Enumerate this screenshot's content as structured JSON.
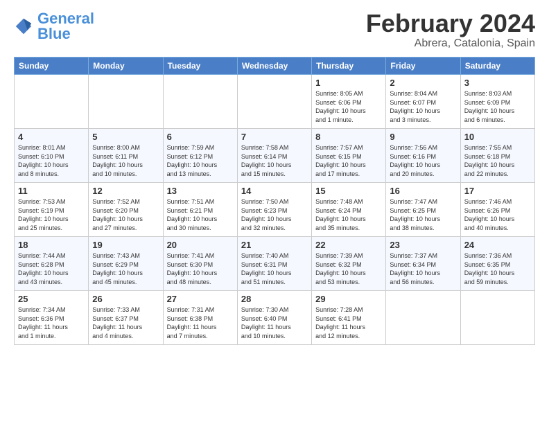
{
  "logo": {
    "line1": "General",
    "line2": "Blue"
  },
  "title": "February 2024",
  "location": "Abrera, Catalonia, Spain",
  "weekdays": [
    "Sunday",
    "Monday",
    "Tuesday",
    "Wednesday",
    "Thursday",
    "Friday",
    "Saturday"
  ],
  "weeks": [
    [
      {
        "day": "",
        "details": ""
      },
      {
        "day": "",
        "details": ""
      },
      {
        "day": "",
        "details": ""
      },
      {
        "day": "",
        "details": ""
      },
      {
        "day": "1",
        "details": "Sunrise: 8:05 AM\nSunset: 6:06 PM\nDaylight: 10 hours\nand 1 minute."
      },
      {
        "day": "2",
        "details": "Sunrise: 8:04 AM\nSunset: 6:07 PM\nDaylight: 10 hours\nand 3 minutes."
      },
      {
        "day": "3",
        "details": "Sunrise: 8:03 AM\nSunset: 6:09 PM\nDaylight: 10 hours\nand 6 minutes."
      }
    ],
    [
      {
        "day": "4",
        "details": "Sunrise: 8:01 AM\nSunset: 6:10 PM\nDaylight: 10 hours\nand 8 minutes."
      },
      {
        "day": "5",
        "details": "Sunrise: 8:00 AM\nSunset: 6:11 PM\nDaylight: 10 hours\nand 10 minutes."
      },
      {
        "day": "6",
        "details": "Sunrise: 7:59 AM\nSunset: 6:12 PM\nDaylight: 10 hours\nand 13 minutes."
      },
      {
        "day": "7",
        "details": "Sunrise: 7:58 AM\nSunset: 6:14 PM\nDaylight: 10 hours\nand 15 minutes."
      },
      {
        "day": "8",
        "details": "Sunrise: 7:57 AM\nSunset: 6:15 PM\nDaylight: 10 hours\nand 17 minutes."
      },
      {
        "day": "9",
        "details": "Sunrise: 7:56 AM\nSunset: 6:16 PM\nDaylight: 10 hours\nand 20 minutes."
      },
      {
        "day": "10",
        "details": "Sunrise: 7:55 AM\nSunset: 6:18 PM\nDaylight: 10 hours\nand 22 minutes."
      }
    ],
    [
      {
        "day": "11",
        "details": "Sunrise: 7:53 AM\nSunset: 6:19 PM\nDaylight: 10 hours\nand 25 minutes."
      },
      {
        "day": "12",
        "details": "Sunrise: 7:52 AM\nSunset: 6:20 PM\nDaylight: 10 hours\nand 27 minutes."
      },
      {
        "day": "13",
        "details": "Sunrise: 7:51 AM\nSunset: 6:21 PM\nDaylight: 10 hours\nand 30 minutes."
      },
      {
        "day": "14",
        "details": "Sunrise: 7:50 AM\nSunset: 6:23 PM\nDaylight: 10 hours\nand 32 minutes."
      },
      {
        "day": "15",
        "details": "Sunrise: 7:48 AM\nSunset: 6:24 PM\nDaylight: 10 hours\nand 35 minutes."
      },
      {
        "day": "16",
        "details": "Sunrise: 7:47 AM\nSunset: 6:25 PM\nDaylight: 10 hours\nand 38 minutes."
      },
      {
        "day": "17",
        "details": "Sunrise: 7:46 AM\nSunset: 6:26 PM\nDaylight: 10 hours\nand 40 minutes."
      }
    ],
    [
      {
        "day": "18",
        "details": "Sunrise: 7:44 AM\nSunset: 6:28 PM\nDaylight: 10 hours\nand 43 minutes."
      },
      {
        "day": "19",
        "details": "Sunrise: 7:43 AM\nSunset: 6:29 PM\nDaylight: 10 hours\nand 45 minutes."
      },
      {
        "day": "20",
        "details": "Sunrise: 7:41 AM\nSunset: 6:30 PM\nDaylight: 10 hours\nand 48 minutes."
      },
      {
        "day": "21",
        "details": "Sunrise: 7:40 AM\nSunset: 6:31 PM\nDaylight: 10 hours\nand 51 minutes."
      },
      {
        "day": "22",
        "details": "Sunrise: 7:39 AM\nSunset: 6:32 PM\nDaylight: 10 hours\nand 53 minutes."
      },
      {
        "day": "23",
        "details": "Sunrise: 7:37 AM\nSunset: 6:34 PM\nDaylight: 10 hours\nand 56 minutes."
      },
      {
        "day": "24",
        "details": "Sunrise: 7:36 AM\nSunset: 6:35 PM\nDaylight: 10 hours\nand 59 minutes."
      }
    ],
    [
      {
        "day": "25",
        "details": "Sunrise: 7:34 AM\nSunset: 6:36 PM\nDaylight: 11 hours\nand 1 minute."
      },
      {
        "day": "26",
        "details": "Sunrise: 7:33 AM\nSunset: 6:37 PM\nDaylight: 11 hours\nand 4 minutes."
      },
      {
        "day": "27",
        "details": "Sunrise: 7:31 AM\nSunset: 6:38 PM\nDaylight: 11 hours\nand 7 minutes."
      },
      {
        "day": "28",
        "details": "Sunrise: 7:30 AM\nSunset: 6:40 PM\nDaylight: 11 hours\nand 10 minutes."
      },
      {
        "day": "29",
        "details": "Sunrise: 7:28 AM\nSunset: 6:41 PM\nDaylight: 11 hours\nand 12 minutes."
      },
      {
        "day": "",
        "details": ""
      },
      {
        "day": "",
        "details": ""
      }
    ]
  ]
}
